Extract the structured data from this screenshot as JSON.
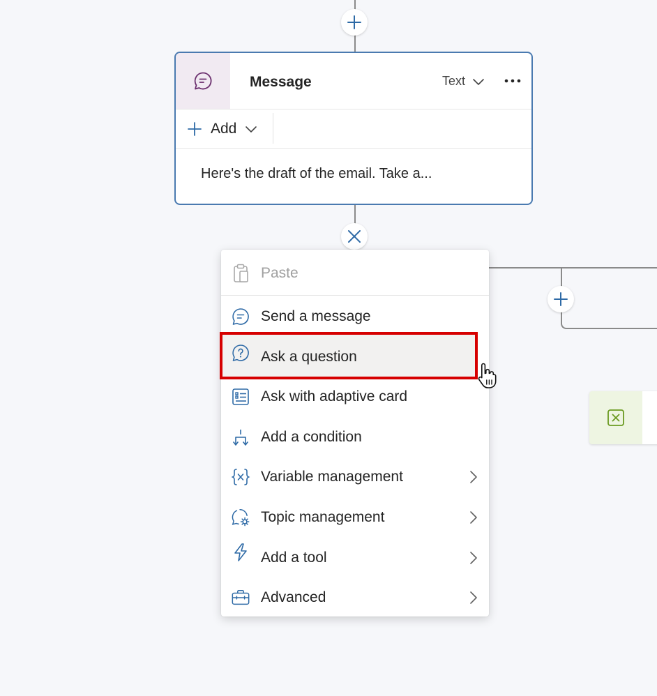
{
  "node": {
    "title": "Message",
    "type_label": "Text",
    "add_label": "Add",
    "body_text": "Here's the draft of the email. Take a..."
  },
  "menu": {
    "paste_label": "Paste",
    "items": [
      {
        "label": "Send a message",
        "icon": "message-icon",
        "has_submenu": false
      },
      {
        "label": "Ask a question",
        "icon": "question-icon",
        "has_submenu": false
      },
      {
        "label": "Ask with adaptive card",
        "icon": "adaptive-card-icon",
        "has_submenu": false
      },
      {
        "label": "Add a condition",
        "icon": "condition-icon",
        "has_submenu": false
      },
      {
        "label": "Variable management",
        "icon": "variable-icon",
        "has_submenu": true
      },
      {
        "label": "Topic management",
        "icon": "topic-icon",
        "has_submenu": true
      },
      {
        "label": "Add a tool",
        "icon": "tool-icon",
        "has_submenu": true
      },
      {
        "label": "Advanced",
        "icon": "toolbox-icon",
        "has_submenu": true
      }
    ],
    "highlighted_item": "Ask a question"
  },
  "colors": {
    "accent": "#4a7ab0",
    "highlight_border": "#d60000",
    "message_icon_bg": "#f1eaf2",
    "message_icon": "#6b2f6e",
    "side_card_bg": "#eef5e2",
    "side_card_icon": "#6a9a20"
  }
}
